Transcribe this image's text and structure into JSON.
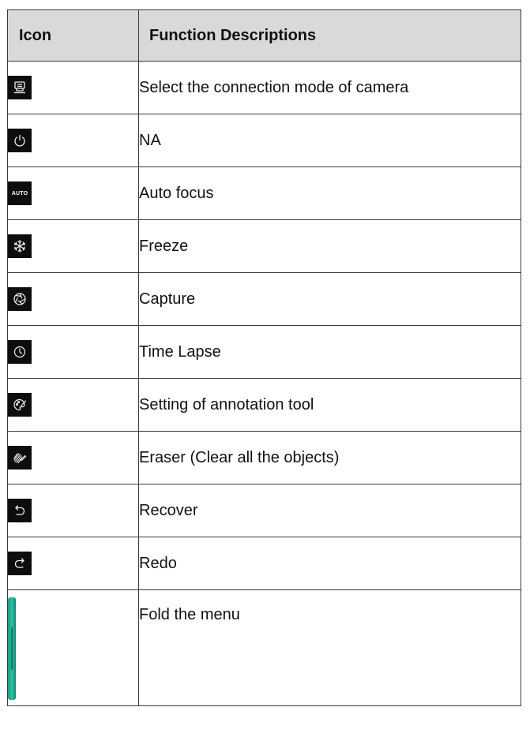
{
  "table": {
    "header": {
      "icon": "Icon",
      "description": "Function Descriptions"
    },
    "rows": [
      {
        "icon": "camera-connection-icon",
        "description": "Select the connection mode of camera"
      },
      {
        "icon": "power-icon",
        "description": "NA"
      },
      {
        "icon": "auto-icon",
        "icon_text": "AUTO",
        "description": "Auto focus"
      },
      {
        "icon": "snowflake-icon",
        "description": "Freeze"
      },
      {
        "icon": "aperture-icon",
        "description": "Capture"
      },
      {
        "icon": "clock-icon",
        "description": "Time Lapse"
      },
      {
        "icon": "palette-icon",
        "description": "Setting of annotation tool"
      },
      {
        "icon": "eraser-icon",
        "description": "Eraser (Clear all the objects)"
      },
      {
        "icon": "undo-icon",
        "description": "Recover"
      },
      {
        "icon": "redo-icon",
        "description": "Redo"
      },
      {
        "icon": "fold-handle-icon",
        "description": "Fold the menu"
      }
    ]
  },
  "colors": {
    "header_bg": "#d9d9d9",
    "icon_bg": "#0d0d0d",
    "fold_handle": "#2fc0a3"
  }
}
